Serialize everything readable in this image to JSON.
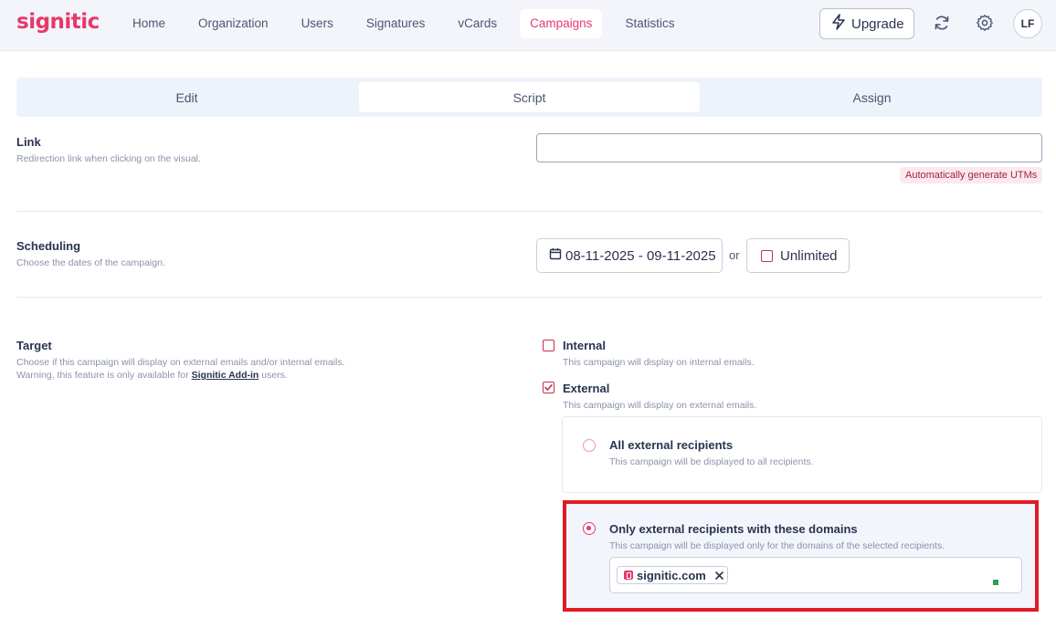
{
  "app": {
    "logo": "signitic"
  },
  "nav": {
    "items": [
      {
        "label": "Home"
      },
      {
        "label": "Organization"
      },
      {
        "label": "Users"
      },
      {
        "label": "Signatures"
      },
      {
        "label": "vCards"
      },
      {
        "label": "Campaigns",
        "active": true
      },
      {
        "label": "Statistics"
      }
    ],
    "upgrade_label": "Upgrade",
    "avatar_initials": "LF"
  },
  "tabs": [
    {
      "label": "Edit"
    },
    {
      "label": "Script",
      "active": true
    },
    {
      "label": "Assign"
    }
  ],
  "link": {
    "title": "Link",
    "description": "Redirection link when clicking on the visual.",
    "value": "",
    "utm_badge": "Automatically generate UTMs"
  },
  "scheduling": {
    "title": "Scheduling",
    "description": "Choose the dates of the campaign.",
    "date_range": "08-11-2025 - 09-11-2025",
    "or_label": "or",
    "unlimited_label": "Unlimited",
    "unlimited_checked": false
  },
  "target": {
    "title": "Target",
    "description_line1": "Choose if this campaign will display on external emails and/or internal emails.",
    "description_prefix": "Warning, this feature is only available for ",
    "description_link": "Signitic Add-in",
    "description_suffix": " users.",
    "internal": {
      "label": "Internal",
      "description": "This campaign will display on internal emails.",
      "checked": false
    },
    "external": {
      "label": "External",
      "description": "This campaign will display on external emails.",
      "checked": true
    },
    "all_external": {
      "label": "All external recipients",
      "description": "This campaign will be displayed to all recipients.",
      "selected": false
    },
    "only_domains": {
      "label": "Only external recipients with these domains",
      "description": "This campaign will be displayed only for the domains of the selected recipients.",
      "selected": true,
      "domains": [
        "signitic.com"
      ]
    }
  },
  "colors": {
    "brand": "#e8386b",
    "highlight": "#e01b24"
  }
}
